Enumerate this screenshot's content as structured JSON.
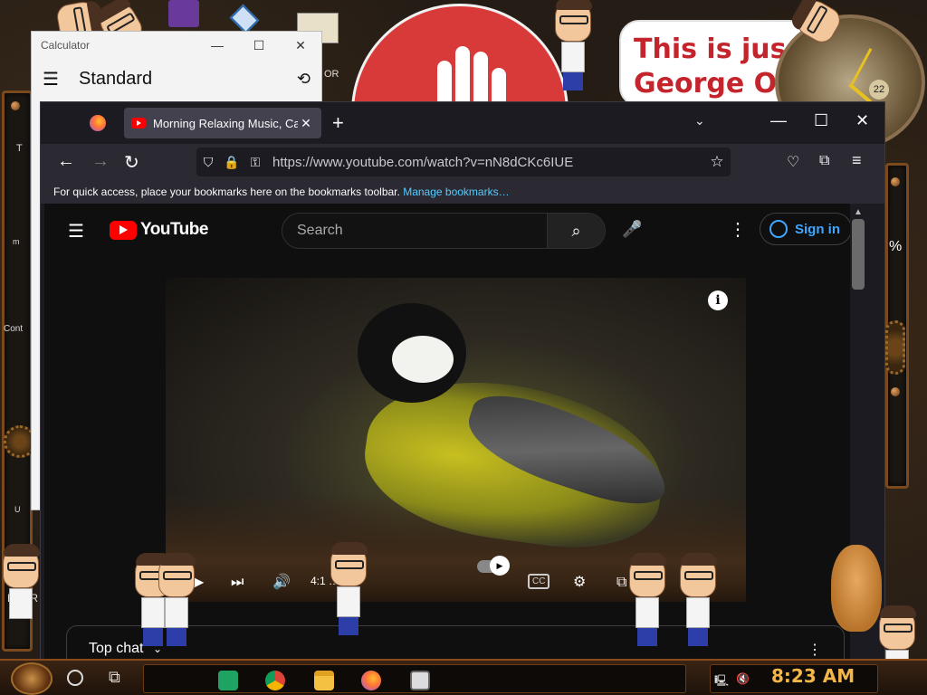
{
  "calculator": {
    "title": "Calculator",
    "mode": "Standard",
    "controls": {
      "minimize": "—",
      "maximize": "☐",
      "close": "✕"
    },
    "menu_icon": "hamburger-icon",
    "history_icon": "history-icon"
  },
  "desktop": {
    "quote_line1": "This is jus",
    "quote_line2": "George O",
    "clock_date": "22",
    "side_labels": {
      "left_t": "T",
      "left_m": "m",
      "left_cont": "Cont",
      "left_nder": "NDER",
      "left_u": "U",
      "right_pct": "%",
      "calc_or": "OR"
    }
  },
  "firefox": {
    "tab": {
      "title": "Morning Relaxing Music, Calm",
      "close": "✕"
    },
    "new_tab": "+",
    "tab_list": "⌄",
    "window": {
      "minimize": "—",
      "maximize": "☐",
      "close": "✕"
    },
    "nav": {
      "back": "←",
      "forward": "→",
      "reload": "↻"
    },
    "url": "https://www.youtube.com/watch?v=nN8dCKc6IUE",
    "url_icons": {
      "shield": "⛉",
      "lock": "🔒",
      "permissions": "⚿",
      "star": "☆"
    },
    "toolbar_icons": {
      "pocket": "♡",
      "extensions": "⧉",
      "menu": "≡"
    },
    "bookmarks_bar": {
      "text": "For quick access, place your bookmarks here on the bookmarks toolbar.",
      "link": "Manage bookmarks…"
    }
  },
  "youtube": {
    "logo_text": "YouTube",
    "search_placeholder": "Search",
    "search_icon": "⌕",
    "mic_icon": "🎤",
    "more_icon": "⋮",
    "sign_in": "Sign in",
    "player": {
      "info": "i",
      "time_display": "4:1 … 32",
      "play_icon": "▶",
      "next_icon": "⏭",
      "volume_icon": "🔊",
      "cc": "CC",
      "settings_icon": "⚙",
      "miniplayer_icon": "⧉",
      "fullscreen_icon": "⛶"
    },
    "top_chat": {
      "label": "Top chat",
      "caret": "⌄",
      "more": "⋮"
    },
    "scroll_up": "▲"
  },
  "taskbar": {
    "time": "8:23 AM",
    "taskview_icon": "⧉",
    "tray": {
      "network": "🖳",
      "volume_muted": "🔇"
    },
    "apps": [
      "sheets-icon",
      "chrome-icon",
      "file-explorer-icon",
      "firefox-icon",
      "calculator-icon"
    ]
  }
}
